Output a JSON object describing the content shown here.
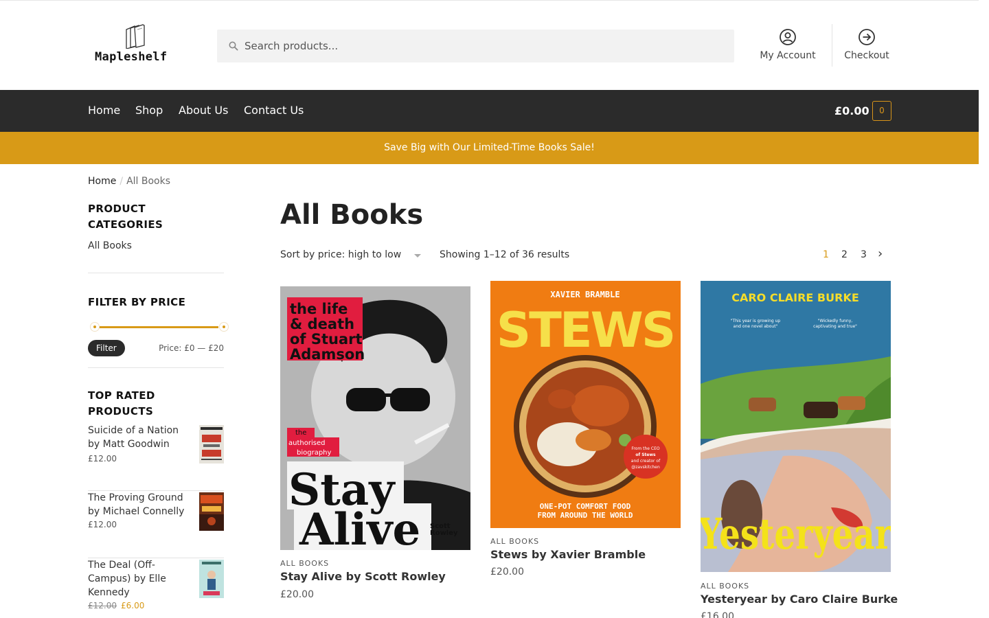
{
  "brand": {
    "name": "Mapleshelf"
  },
  "search": {
    "placeholder": "Search products..."
  },
  "header_links": {
    "account": "My Account",
    "checkout": "Checkout"
  },
  "nav": {
    "items": [
      "Home",
      "Shop",
      "About Us",
      "Contact Us"
    ]
  },
  "cart": {
    "total": "£0.00",
    "count": "0"
  },
  "banner": {
    "text": "Save Big with Our Limited-Time Books Sale!"
  },
  "breadcrumb": {
    "home": "Home",
    "separator": "/",
    "current": "All Books"
  },
  "sidebar": {
    "categories_title": "PRODUCT CATEGORIES",
    "categories": [
      "All Books"
    ],
    "filter_title": "FILTER BY PRICE",
    "filter_button": "Filter",
    "price_label": "Price: £0 — £20",
    "top_rated_title": "TOP RATED PRODUCTS",
    "top_rated": [
      {
        "title": "Suicide of a Nation by Matt Goodwin",
        "price": "£12.00",
        "old_price": "",
        "thumb_color": "#d1cfc6"
      },
      {
        "title": "The Proving Ground by Michael Connelly",
        "price": "£12.00",
        "old_price": "",
        "thumb_color": "#7a3a1e"
      },
      {
        "title": "The Deal (Off-Campus) by Elle Kennedy",
        "price": "£6.00",
        "old_price": "£12.00",
        "thumb_color": "#9fd2cf"
      }
    ]
  },
  "main": {
    "title": "All Books",
    "sort_label": "Sort by price: high to low",
    "result_count": "Showing 1–12 of 36 results",
    "pages": [
      "1",
      "2",
      "3",
      "›"
    ],
    "products": [
      {
        "category": "ALL BOOKS",
        "title": "Stay Alive by Scott Rowley",
        "price": "£20.00",
        "cover": {
          "top_text": "the life & death of Stuart Adamson",
          "badge": "the authorised biography",
          "big_text": "Stay Alive",
          "author": "Scott Rowley"
        }
      },
      {
        "category": "ALL BOOKS",
        "title": "Stews by Xavier Bramble",
        "price": "£20.00",
        "cover": {
          "author": "XAVIER BRAMBLE",
          "big_text": "STEWS",
          "tagline": "ONE-POT COMFORT FOOD FROM AROUND THE WORLD",
          "sticker": "From the CEO of Stews and creator of @zavskitchen"
        }
      },
      {
        "category": "ALL BOOKS",
        "title": "Yesteryear by Caro Claire Burke",
        "price": "£16.00",
        "cover": {
          "author": "CARO CLAIRE BURKE",
          "big_text": "Yesteryear"
        }
      }
    ]
  },
  "colors": {
    "accent": "#d89a17",
    "nav_bg": "#2b2b2b"
  }
}
